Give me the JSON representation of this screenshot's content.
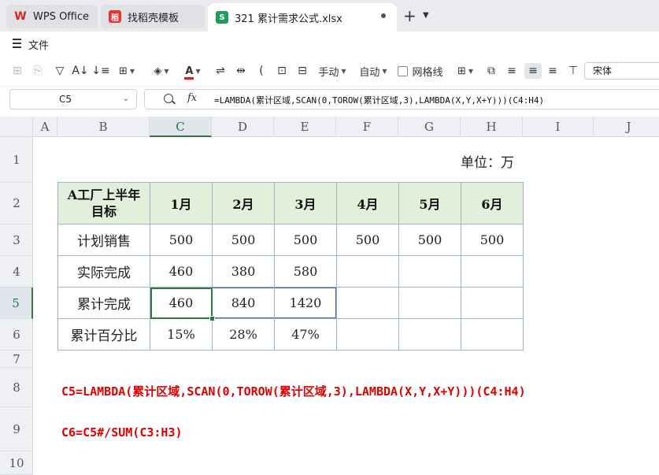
{
  "tabs": [
    {
      "label": "WPS Office",
      "icon": "wps-logo-icon"
    },
    {
      "label": "找稻壳模板",
      "icon": "daoke-icon"
    },
    {
      "label": "321 累计需求公式.xlsx",
      "icon": "spreadsheet-icon",
      "active": true
    }
  ],
  "menu": {
    "file": "文件"
  },
  "toolbar": {
    "manual": "手动",
    "auto": "自动",
    "gridlines": "网格线",
    "font_name": "宋体"
  },
  "formula_bar": {
    "cell_ref": "C5",
    "fx": "fx",
    "formula": "=LAMBDA(累计区域,SCAN(0,TOROW(累计区域,3),LAMBDA(X,Y,X+Y)))(C4:H4)"
  },
  "grid": {
    "columns": [
      "A",
      "B",
      "C",
      "D",
      "E",
      "F",
      "G",
      "H",
      "I",
      "J"
    ],
    "rows": [
      "1",
      "2",
      "3",
      "4",
      "5",
      "6",
      "7",
      "8",
      "9",
      "10"
    ],
    "selected_column": "C",
    "selected_row": "5"
  },
  "sheet": {
    "unit": "单位：万",
    "table": {
      "header": {
        "corner": "A工厂上半年目标",
        "months": [
          "1月",
          "2月",
          "3月",
          "4月",
          "5月",
          "6月"
        ]
      },
      "rows": [
        {
          "label": "计划销售",
          "values": [
            "500",
            "500",
            "500",
            "500",
            "500",
            "500"
          ]
        },
        {
          "label": "实际完成",
          "values": [
            "460",
            "380",
            "580",
            "",
            "",
            ""
          ]
        },
        {
          "label": "累计完成",
          "values": [
            "460",
            "840",
            "1420",
            "",
            "",
            ""
          ]
        },
        {
          "label": "累计百分比",
          "values": [
            "15%",
            "28%",
            "47%",
            "",
            "",
            ""
          ]
        }
      ]
    },
    "notes": [
      "C5=LAMBDA(累计区域,SCAN(0,TOROW(累计区域,3),LAMBDA(X,Y,X+Y)))(C4:H4)",
      "C6=C5#/SUM(C3:H3)"
    ]
  },
  "colors": {
    "accent_green": "#2c7a3e",
    "header_fill": "#e2efdb",
    "note_red": "#e00000"
  }
}
